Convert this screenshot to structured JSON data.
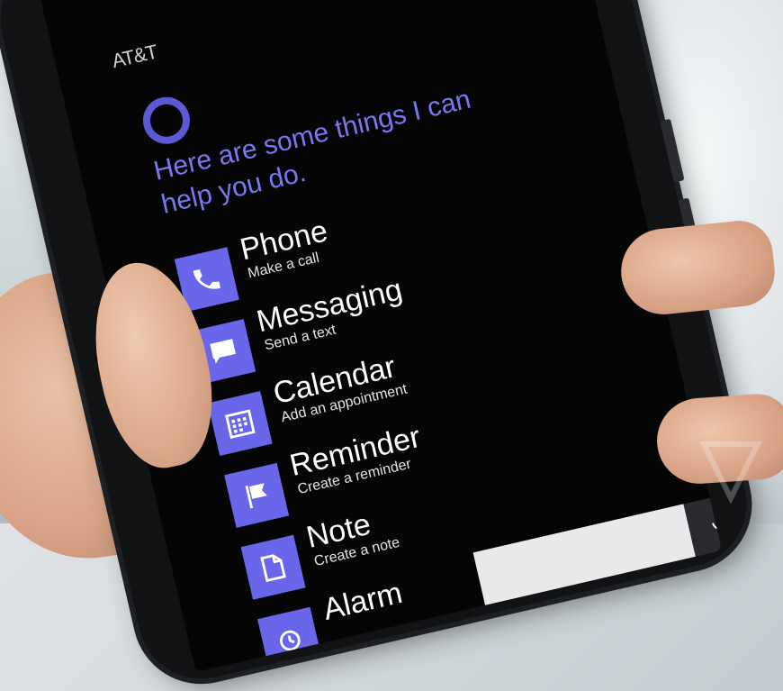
{
  "status_bar": {
    "carrier": "AT&T"
  },
  "cortana": {
    "heading": "Here are some things I can help you do."
  },
  "items": [
    {
      "name": "Phone",
      "sub": "Make a call",
      "icon": "phone-icon"
    },
    {
      "name": "Messaging",
      "sub": "Send a text",
      "icon": "message-icon"
    },
    {
      "name": "Calendar",
      "sub": "Add an appointment",
      "icon": "calendar-icon"
    },
    {
      "name": "Reminder",
      "sub": "Create a reminder",
      "icon": "flag-icon"
    },
    {
      "name": "Note",
      "sub": "Create a note",
      "icon": "note-icon"
    },
    {
      "name": "Alarm",
      "sub": "",
      "icon": "alarm-icon"
    }
  ],
  "input": {
    "mic_icon": "microphone-icon"
  },
  "colors": {
    "accent": "#6a66ea",
    "heading": "#7a78f0",
    "screen": "#050506"
  }
}
